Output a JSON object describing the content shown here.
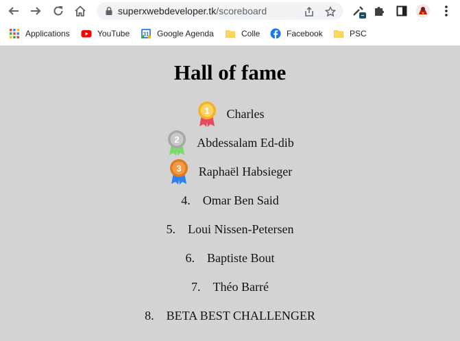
{
  "browser": {
    "url_host": "superxwebdeveloper.tk",
    "url_path": "/scoreboard",
    "bookmarks": [
      {
        "label": "Applications",
        "icon": "apps-grid-icon"
      },
      {
        "label": "YouTube",
        "icon": "youtube-icon"
      },
      {
        "label": "Google Agenda",
        "icon": "calendar-icon"
      },
      {
        "label": "Colle",
        "icon": "folder-icon"
      },
      {
        "label": "Facebook",
        "icon": "facebook-icon"
      },
      {
        "label": "PSC",
        "icon": "folder-icon"
      }
    ]
  },
  "page": {
    "title": "Hall of fame",
    "entries": [
      {
        "rank": "1",
        "medal": "gold",
        "name": "Charles"
      },
      {
        "rank": "2",
        "medal": "silver",
        "name": "Abdessalam Ed-dib"
      },
      {
        "rank": "3",
        "medal": "bronze",
        "name": "Raphaël Habsieger"
      },
      {
        "rank": "4.",
        "name": "Omar Ben Said"
      },
      {
        "rank": "5.",
        "name": "Loui Nissen-Petersen"
      },
      {
        "rank": "6.",
        "name": "Baptiste Bout"
      },
      {
        "rank": "7.",
        "name": "Théo Barré"
      },
      {
        "rank": "8.",
        "name": "BETA BEST CHALLENGER"
      }
    ]
  },
  "colors": {
    "page_background": "#d3d3d3",
    "gold": "#f5b324",
    "silver": "#a8a8a8",
    "bronze": "#e07b1f"
  }
}
